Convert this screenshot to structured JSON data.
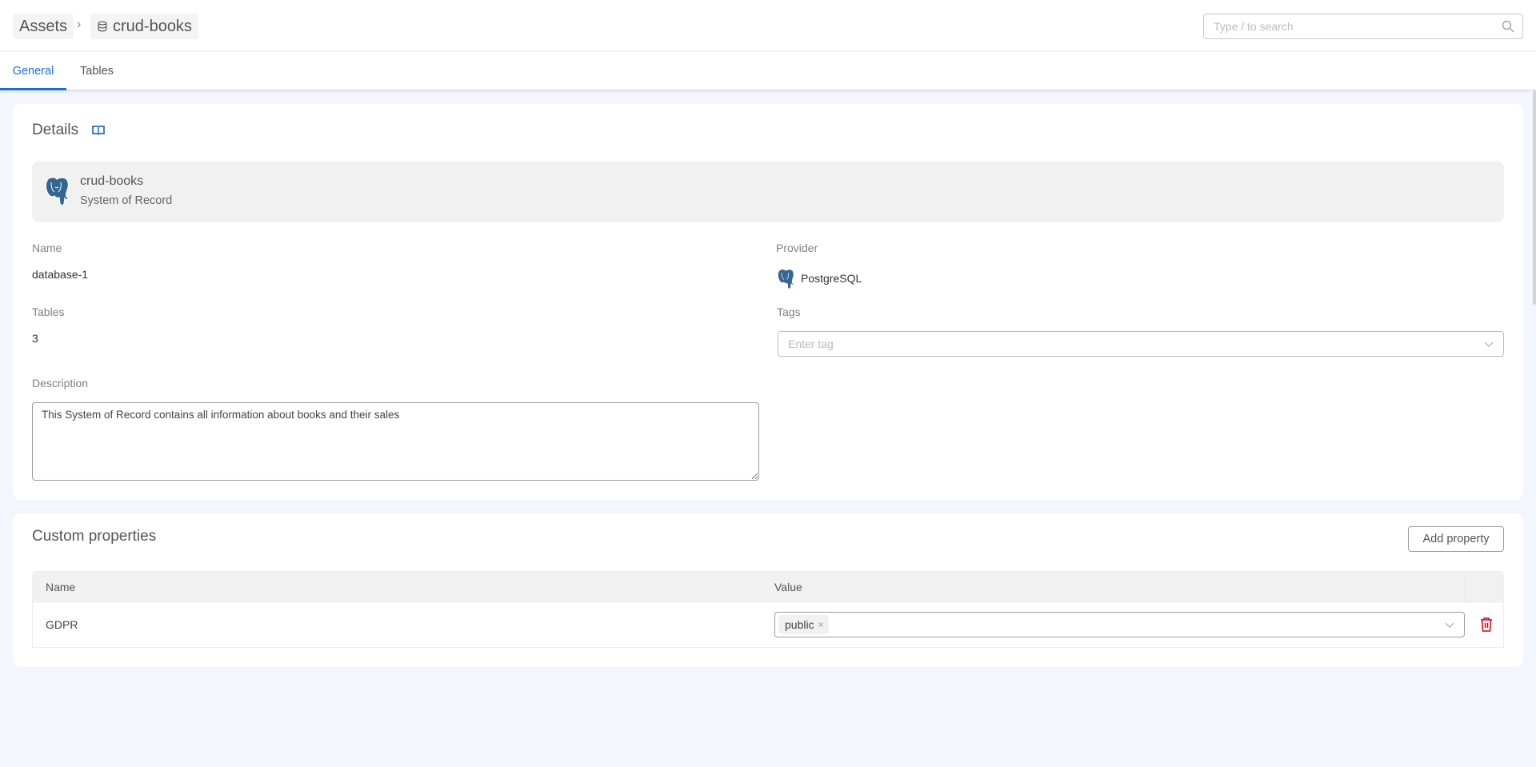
{
  "header": {
    "breadcrumbs": [
      {
        "label": "Assets"
      },
      {
        "label": "crud-books",
        "icon": "database-icon"
      }
    ],
    "separator": "›",
    "search": {
      "placeholder": "Type / to search",
      "value": "",
      "icon": "search-icon"
    }
  },
  "tabs": [
    {
      "label": "General",
      "active": true
    },
    {
      "label": "Tables",
      "active": false
    }
  ],
  "details": {
    "title": "Details",
    "title_icon": "book-open-icon",
    "hero": {
      "icon": "postgresql-icon",
      "name": "crud-books",
      "subtitle": "System of Record"
    },
    "fields": {
      "name": {
        "label": "Name",
        "value": "database-1"
      },
      "provider": {
        "label": "Provider",
        "value": "PostgreSQL",
        "icon": "postgresql-icon"
      },
      "tables": {
        "label": "Tables",
        "value": "3"
      },
      "tags": {
        "label": "Tags",
        "placeholder": "Enter tag",
        "value": ""
      },
      "description": {
        "label": "Description",
        "value": "This System of Record contains all information about books and their sales"
      }
    }
  },
  "custom_properties": {
    "title": "Custom properties",
    "add_button": "Add property",
    "columns": [
      "Name",
      "Value"
    ],
    "rows": [
      {
        "name": "GDPR",
        "values": [
          {
            "label": "public",
            "remove": "×"
          }
        ]
      }
    ]
  },
  "colors": {
    "accent": "#1a6fd9",
    "danger": "#d0021b",
    "page_bg": "#f3f7fd",
    "postgres_blue": "#336791"
  }
}
